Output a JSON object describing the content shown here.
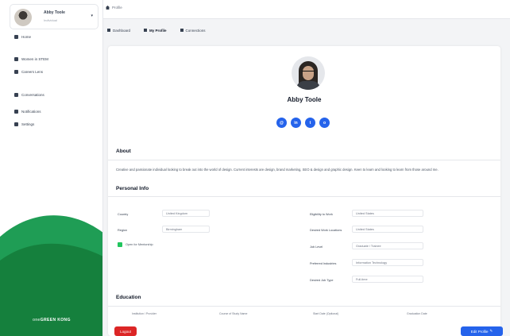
{
  "sidebar": {
    "user": {
      "name": "Abby Toole",
      "role": "Individual"
    },
    "items": [
      {
        "label": "Home",
        "icon": "home-icon"
      },
      {
        "label": "Women in STEM",
        "icon": "people-icon"
      },
      {
        "label": "Careers Lens",
        "icon": "briefcase-icon"
      },
      {
        "label": "Conversations",
        "icon": "chat-icon"
      },
      {
        "label": "Notifications",
        "icon": "bell-icon"
      },
      {
        "label": "Settings",
        "icon": "gear-icon"
      }
    ],
    "brand": "GREEN KONG",
    "brand_prefix": "one"
  },
  "topbar": {
    "breadcrumb": "Profile"
  },
  "tabs": [
    {
      "label": "Dashboard",
      "icon": "dashboard-icon",
      "active": false
    },
    {
      "label": "My Profile",
      "icon": "user-icon",
      "active": true
    },
    {
      "label": "Connections",
      "icon": "connections-icon",
      "active": false
    }
  ],
  "profile": {
    "name": "Abby Toole",
    "socials": [
      "email-icon",
      "linkedin-icon",
      "twitter-icon",
      "instagram-icon"
    ],
    "social_glyphs": [
      "@",
      "in",
      "t",
      "o"
    ],
    "about_title": "About",
    "about_text": "Creative and passionate individual looking to break out into the world of design. Current interests are design, brand marketing, SEO & design and graphic design. Keen to learn and looking to learn from those around me.",
    "personal_title": "Personal Info",
    "fields_left": [
      {
        "label": "Country",
        "value": "United Kingdom"
      },
      {
        "label": "Region",
        "value": "Birmingham"
      }
    ],
    "open_label": "Open for Mentorship",
    "fields_right": [
      {
        "label": "Eligibility to Work",
        "value": "United States"
      },
      {
        "label": "Desired Work Locations",
        "value": "United States"
      },
      {
        "label": "Job Level",
        "value": "Graduate / Trainee"
      },
      {
        "label": "Preferred Industries",
        "value": "Information Technology"
      },
      {
        "label": "Desired Job Type",
        "value": "Full-time"
      }
    ],
    "education_title": "Education",
    "education_cols": [
      "Institution / Provider",
      "Course of Study Name",
      "Start Date (Optional)",
      "Graduation Date"
    ]
  },
  "actions": {
    "logout": "Logout",
    "edit": "Edit Profile"
  },
  "colors": {
    "accent": "#2563eb",
    "danger": "#dc2626",
    "brand_green": "#15803d",
    "check": "#22c55e"
  }
}
